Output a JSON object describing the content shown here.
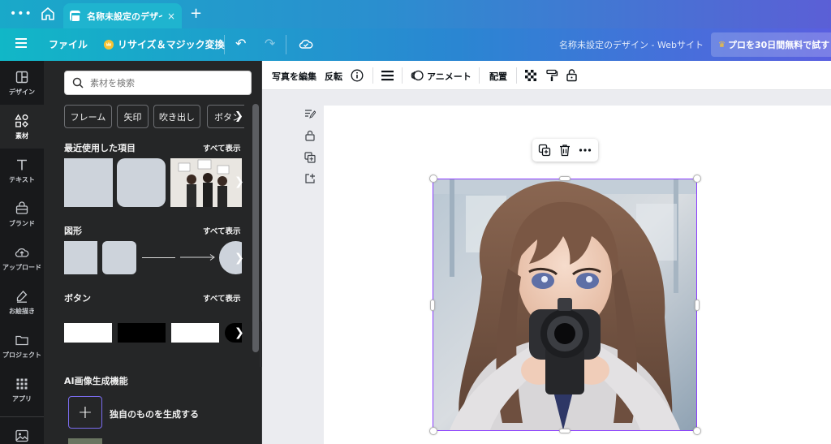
{
  "browser": {
    "tab_title": "名称未設定のデザイ...",
    "tab_close": "×",
    "new_tab": "+"
  },
  "menubar": {
    "file": "ファイル",
    "resize": "リサイズ＆マジック変換",
    "doc_title": "名称未設定のデザイン - Webサイト",
    "pro_label": "プロを30日間無料で試す"
  },
  "rail": {
    "items": [
      {
        "label": "デザイン",
        "icon": "layout-icon"
      },
      {
        "label": "素材",
        "icon": "shapes-icon"
      },
      {
        "label": "テキスト",
        "icon": "text-icon"
      },
      {
        "label": "ブランド",
        "icon": "brand-icon"
      },
      {
        "label": "アップロード",
        "icon": "upload-icon"
      },
      {
        "label": "お絵描き",
        "icon": "draw-icon"
      },
      {
        "label": "プロジェクト",
        "icon": "folder-icon"
      },
      {
        "label": "アプリ",
        "icon": "apps-icon"
      }
    ]
  },
  "panel": {
    "search_placeholder": "素材を検索",
    "chips": [
      "フレーム",
      "矢印",
      "吹き出し",
      "ボタン"
    ],
    "recent_title": "最近使用した項目",
    "shapes_title": "図形",
    "buttons_title": "ボタン",
    "see_all": "すべて表示",
    "ai_title": "AI画像生成機能",
    "ai_generate": "独自のものを生成する",
    "ai_plus": "+"
  },
  "toolbar": {
    "edit_photo": "写真を編集",
    "flip": "反転",
    "animate": "アニメート",
    "position": "配置"
  },
  "colors": {
    "accent": "#8b3dff",
    "rail_bg": "#18191b",
    "panel_bg": "#252627",
    "tile": "#cdd3db"
  }
}
